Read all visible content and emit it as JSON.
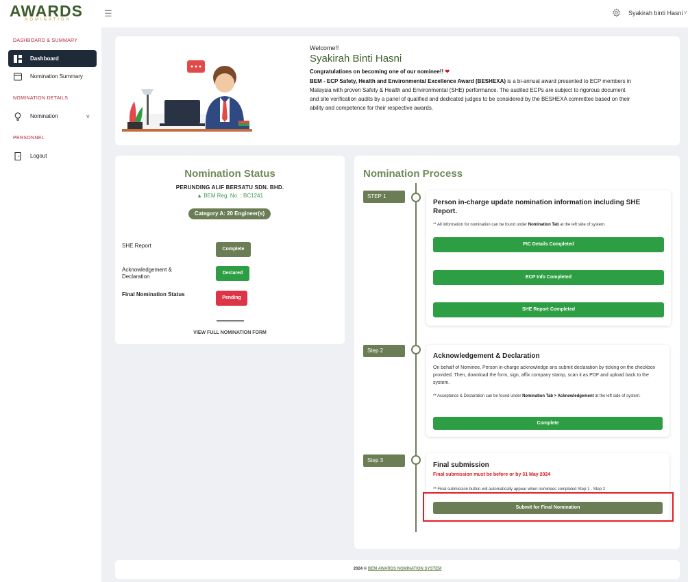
{
  "header": {
    "logo_main": "AWARDS",
    "logo_sub": "NOMINATION",
    "user_name": "Syakirah binti Hasni",
    "icons": [
      "menu-icon",
      "gear-icon",
      "chevron-down-icon"
    ]
  },
  "sidebar": {
    "section_dashboard": "DASHBOARD & SUMMARY",
    "item_dashboard": "Dashboard",
    "item_summary": "Nomination Summary",
    "section_details": "NOMINATION DETAILS",
    "item_nomination": "Nomination",
    "section_personnel": "PERSONNEL",
    "item_logout": "Logout"
  },
  "welcome": {
    "greeting": "Welcome!!",
    "name": "Syakirah Binti Hasni",
    "congrats": "Congratulations on becoming one of our nominee!!",
    "award_name": "BEM - ECP Safety, Health and Environmental Excellence Award (BESHEXA)",
    "body": "is a bi-annual award presented to ECP members in Malaysia with proven Safety & Health and Environmental (SHE) performance. The audited ECPs are subject to rigorous document and site verification audits by a panel of qualified and dedicated judges to be considered by the BESHEXA committee based on their ability and competence for their respective awards."
  },
  "status": {
    "title": "Nomination Status",
    "company": "PERUNDING ALIF BERSATU SDN. BHD.",
    "reg_no": "BEM Reg. No. : BC1241",
    "category": "Category A: 20 Engineer(s)",
    "rows": [
      {
        "label": "SHE Report",
        "status": "Complete",
        "color": "#6b7d55"
      },
      {
        "label": "Acknowledgement & Declaration",
        "status": "Declared",
        "color": "#2e9e44"
      },
      {
        "label": "Final Nomination Status",
        "status": "Pending",
        "color": "#dc3545"
      }
    ],
    "view_full": "VIEW FULL NOMINATION FORM"
  },
  "process": {
    "title": "Nomination Process",
    "step1": {
      "tag": "STEP 1",
      "title": "Person in-charge update nomination information including SHE Report.",
      "note_pre": "** All information for nomination can be found under ",
      "note_bold": "Nomination Tab",
      "note_post": " at the left side of system.",
      "btn_pic": "PIC Details Completed",
      "btn_ecp": "ECP Info Completed",
      "btn_she": "SHE Report Completed"
    },
    "step2": {
      "tag": "Step 2",
      "title": "Acknowledgement & Declaration",
      "desc": "On behalf of Nominee, Person in-charge acknowledge ans submit declaration by ticking on the checkbox provided. Then, download the form, sign, affix company stamp, scan it as PDF and upload back to the system.",
      "note_pre": "** Acceptance & Declaration can be found under ",
      "note_bold": "Nomination Tab > Acknowledgement",
      "note_post": " at the left side of system.",
      "btn": "Complete"
    },
    "step3": {
      "tag": "Step 3",
      "title": "Final submission",
      "deadline": "Final submission must be before or by 31 May 2024",
      "note": "** Final submission button will automatically appear when nominees completed Step 1 - Step 2",
      "btn": "Submit for Final Nomination"
    }
  },
  "footer": {
    "year": "2024 ©",
    "link": "BEM AWARDS NOMINATION SYSTEM"
  }
}
